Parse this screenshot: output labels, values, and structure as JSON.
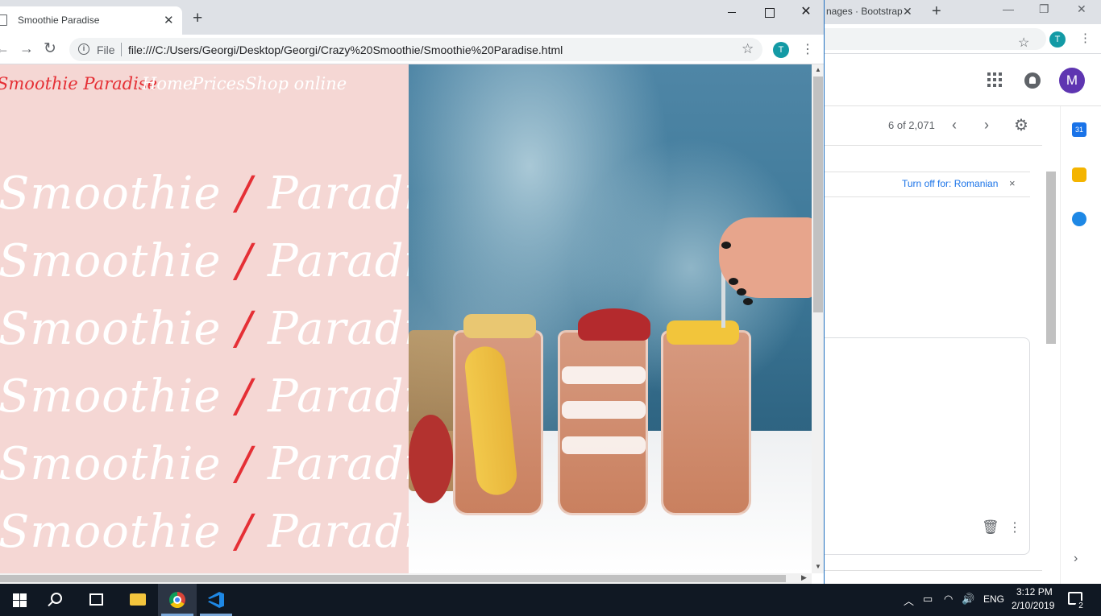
{
  "background_window": {
    "tab_title": "nages · Bootstrap",
    "close_glyph": "✕",
    "newtab_glyph": "+",
    "min_glyph": "—",
    "restore_glyph": "❐",
    "close_win_glyph": "✕",
    "star_glyph": "☆",
    "profile_letter": "T",
    "menu_glyph": "⋮",
    "gmail": {
      "avatar_letter": "M",
      "avatar_color": "#5e35b1",
      "pager_text": "6 of 2,071",
      "prev_glyph": "‹",
      "next_glyph": "›",
      "gear_glyph": "⚙",
      "turn_off_text": "Turn off for: Romanian",
      "turn_off_close": "×",
      "trash_glyph": "🗑",
      "more_glyph": "⋮",
      "side_calendar_text": "31",
      "side_chevron": "›",
      "side_icons": [
        "calendar-icon",
        "keep-icon",
        "tasks-icon"
      ]
    }
  },
  "browser": {
    "tab_title": "Smoothie Paradise",
    "tab_close": "✕",
    "newtab": "+",
    "close_glyph": "✕",
    "back_glyph": "←",
    "forward_glyph": "→",
    "reload_glyph": "↻",
    "info_glyph": "i",
    "scheme_label": "File",
    "url": "file:///C:/Users/Georgi/Desktop/Georgi/Crazy%20Smoothie/Smoothie%20Paradise.html",
    "star_glyph": "☆",
    "profile_letter": "T",
    "menu_glyph": "⋮",
    "scroll_up": "▲",
    "scroll_down": "▼",
    "scroll_right": "▶"
  },
  "page": {
    "brand": "Smoothie Paradise",
    "nav": [
      {
        "label": "Home"
      },
      {
        "label": "Prices"
      },
      {
        "label": "Shop online"
      }
    ],
    "hero_line": {
      "left": "Smoothie",
      "slash": "/",
      "right": "Paradise"
    },
    "hero_repeat": 6,
    "colors": {
      "panel_pink": "#f5d7d4",
      "accent_red": "#e52f35"
    },
    "image": "smoothie-glasses-photo"
  },
  "taskbar": {
    "apps": [
      "start-icon",
      "search-icon",
      "task-view-icon",
      "file-explorer-icon",
      "chrome-icon",
      "vscode-icon"
    ],
    "tray_chevron": "︿",
    "battery_glyph": "▭",
    "wifi_glyph": "◠",
    "volume_glyph": "🔊",
    "language": "ENG",
    "time": "3:12 PM",
    "date": "2/10/2019",
    "notification_count": "2"
  }
}
